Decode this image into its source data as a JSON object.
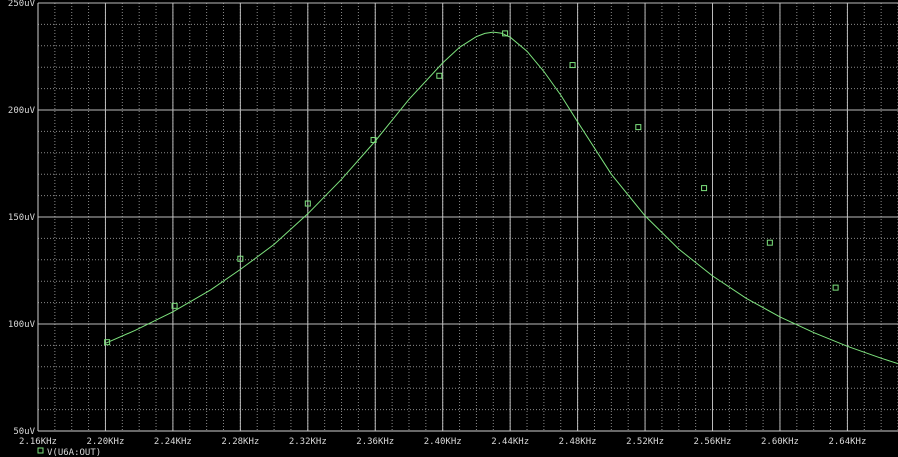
{
  "chart_data": {
    "type": "line",
    "title": "",
    "xlabel": "",
    "ylabel": "",
    "x_unit": "KHz",
    "y_unit": "uV",
    "xlim": [
      2.16,
      2.67
    ],
    "ylim": [
      50,
      250
    ],
    "x_ticks": [
      "2.16KHz",
      "2.20KHz",
      "2.24KHz",
      "2.28KHz",
      "2.32KHz",
      "2.36KHz",
      "2.40KHz",
      "2.44KHz",
      "2.48KHz",
      "2.52KHz",
      "2.56KHz",
      "2.60KHz",
      "2.64KHz"
    ],
    "x_tick_values": [
      2.16,
      2.2,
      2.24,
      2.28,
      2.32,
      2.36,
      2.4,
      2.44,
      2.48,
      2.52,
      2.56,
      2.6,
      2.64
    ],
    "y_ticks": [
      "50uV",
      "100uV",
      "150uV",
      "200uV",
      "250uV"
    ],
    "y_tick_values": [
      50,
      100,
      150,
      200,
      250
    ],
    "grid": true,
    "legend_position": "bottom-left",
    "series": [
      {
        "name": "V(U6A:OUT)",
        "color": "#7ee37e",
        "marker": "square",
        "x": [
          2.2,
          2.2175,
          2.24,
          2.2625,
          2.28,
          2.3,
          2.32,
          2.34,
          2.36,
          2.38,
          2.4,
          2.41,
          2.42,
          2.425,
          2.43,
          2.435,
          2.44,
          2.45,
          2.46,
          2.47,
          2.48,
          2.5,
          2.52,
          2.54,
          2.56,
          2.58,
          2.6,
          2.62,
          2.64,
          2.66,
          2.67
        ],
        "y": [
          91.0,
          97.0,
          105.7,
          116.0,
          125.5,
          137.2,
          151.5,
          167.6,
          185.5,
          205.0,
          222.0,
          229.3,
          234.3,
          235.8,
          236.4,
          235.9,
          234.0,
          227.5,
          218.0,
          207.0,
          194.5,
          170.0,
          150.5,
          135.0,
          122.5,
          112.0,
          103.3,
          96.0,
          89.6,
          84.0,
          81.5
        ]
      }
    ],
    "markers": {
      "x": [
        2.201,
        2.241,
        2.28,
        2.32,
        2.359,
        2.398,
        2.437,
        2.477,
        2.516,
        2.555,
        2.594,
        2.633
      ],
      "y": [
        91.5,
        108.5,
        130.5,
        156.3,
        186.0,
        216.0,
        235.8,
        221.0,
        192.0,
        163.5,
        138.0,
        117.0
      ]
    }
  },
  "colors": {
    "background": "#000000",
    "grid": "#8a8a8a",
    "axis_text": "#d8d8d8"
  },
  "legend": {
    "items": [
      {
        "label": "V(U6A:OUT)",
        "marker": "square"
      }
    ]
  }
}
